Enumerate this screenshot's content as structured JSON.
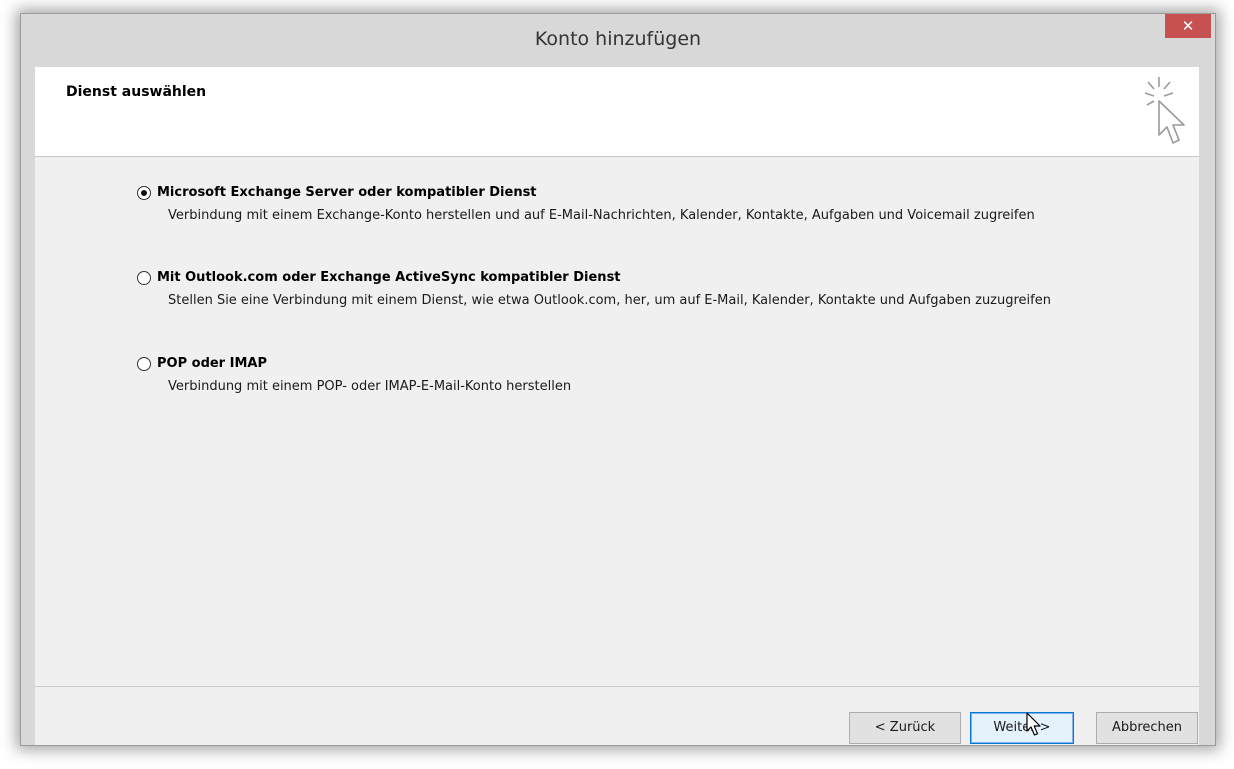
{
  "window": {
    "title": "Konto hinzufügen",
    "close_glyph": "✕"
  },
  "header": {
    "title": "Dienst auswählen",
    "icon": "wizard-pointer-icon"
  },
  "options": [
    {
      "label": "Microsoft Exchange Server oder kompatibler Dienst",
      "description": "Verbindung mit einem Exchange-Konto herstellen und auf E-Mail-Nachrichten, Kalender, Kontakte, Aufgaben und Voicemail zugreifen",
      "selected": true
    },
    {
      "label": "Mit Outlook.com oder Exchange ActiveSync kompatibler Dienst",
      "description": "Stellen Sie eine Verbindung mit einem Dienst, wie etwa Outlook.com, her, um auf E-Mail, Kalender, Kontakte und Aufgaben zuzugreifen",
      "selected": false
    },
    {
      "label": "POP oder IMAP",
      "description": "Verbindung mit einem POP- oder IMAP-E-Mail-Konto herstellen",
      "selected": false
    }
  ],
  "buttons": {
    "back": "< Zurück",
    "next": "Weiter >",
    "cancel": "Abbrechen"
  },
  "colors": {
    "close_button": "#c75050",
    "focus_border": "#0078d7"
  }
}
